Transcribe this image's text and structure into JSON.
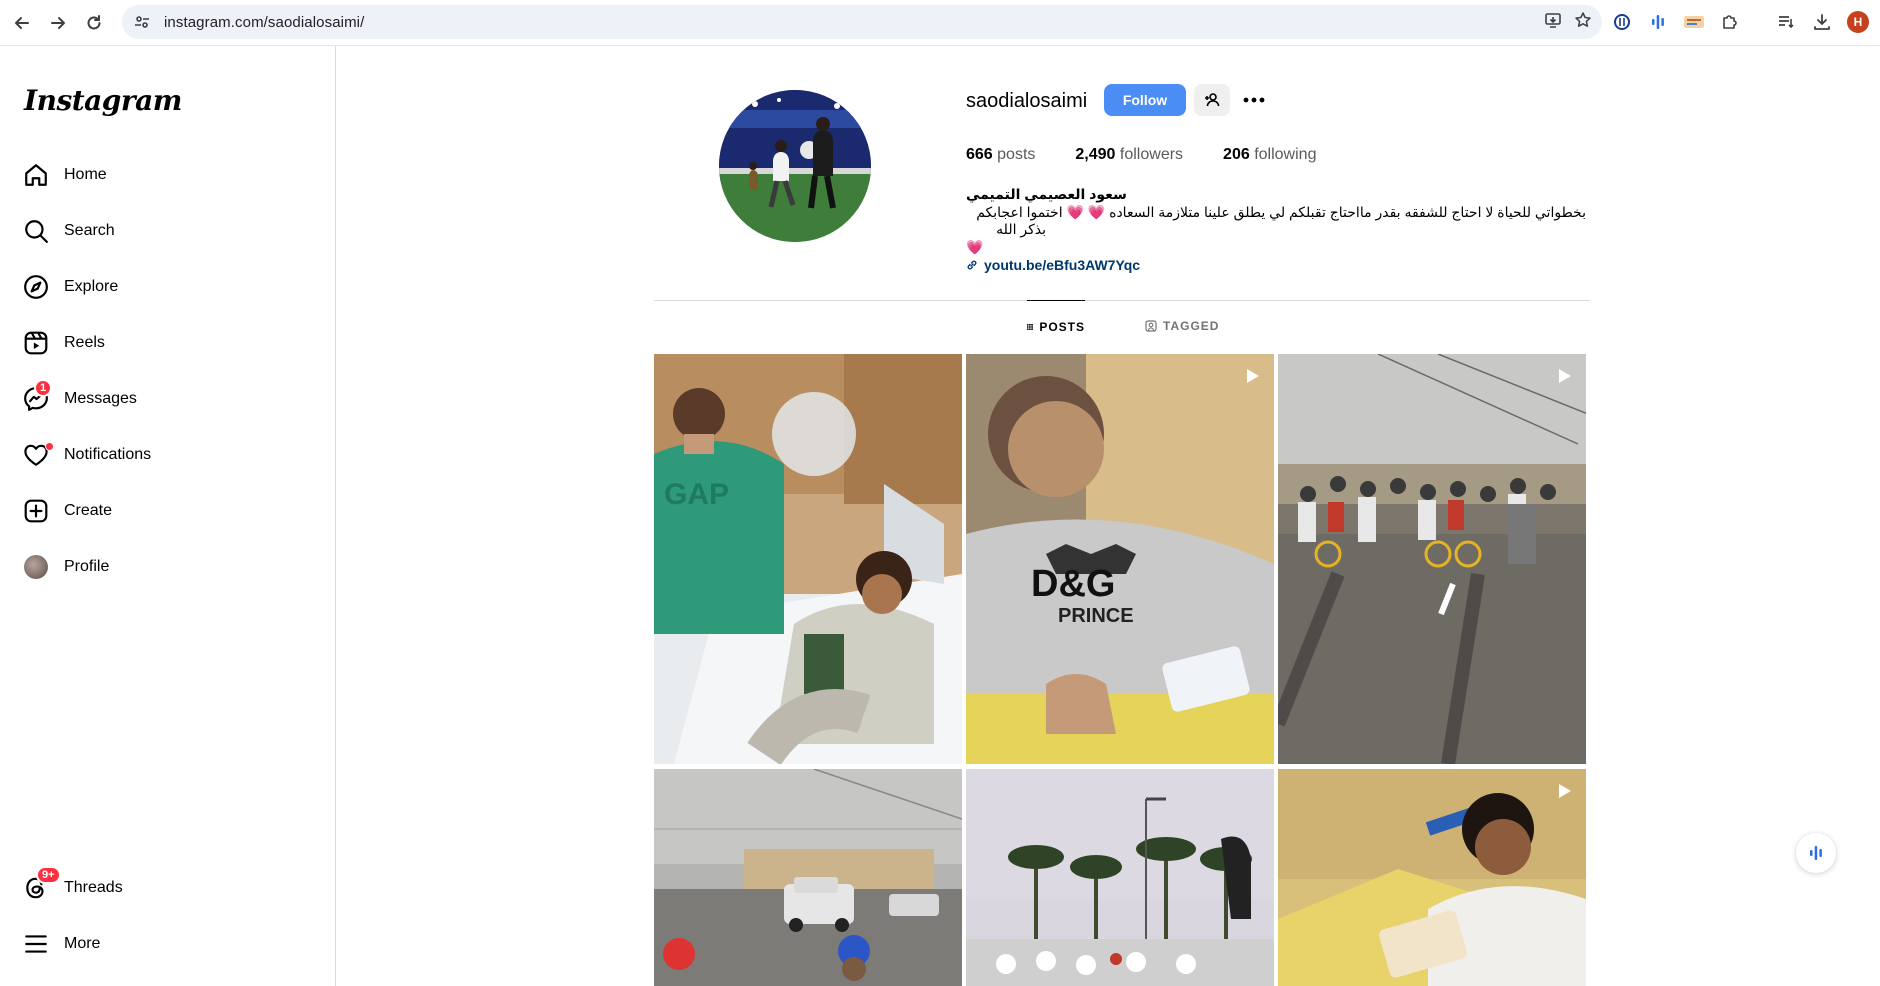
{
  "browser": {
    "url": "instagram.com/saodialosaimi/",
    "profile_initial": "H"
  },
  "sidebar": {
    "logo": "Instagram",
    "items": [
      {
        "label": "Home"
      },
      {
        "label": "Search"
      },
      {
        "label": "Explore"
      },
      {
        "label": "Reels"
      },
      {
        "label": "Messages",
        "badge": "1"
      },
      {
        "label": "Notifications"
      },
      {
        "label": "Create"
      },
      {
        "label": "Profile"
      },
      {
        "label": "Threads",
        "badge": "9+"
      },
      {
        "label": "More"
      }
    ]
  },
  "profile": {
    "username": "saodialosaimi",
    "follow_label": "Follow",
    "stats": {
      "posts_count": "666",
      "posts_label": "posts",
      "followers_count": "2,490",
      "followers_label": "followers",
      "following_count": "206",
      "following_label": "following"
    },
    "full_name": "سعود العصيمي التميمي",
    "bio_line1": "بخطواتي للحياة لا احتاج للشفقه بقدر مااحتاج تقبلكم لي يطلق علينا متلازمة السعاده 💗 💗 اختموا اعجابكم",
    "bio_line2": "بذكر الله",
    "bio_line3": "💗",
    "link": "youtu.be/eBfu3AW7Yqc"
  },
  "tabs": [
    {
      "label": "POSTS",
      "active": true
    },
    {
      "label": "TAGGED",
      "active": false
    }
  ],
  "posts": [
    {
      "kind": "photo",
      "overlay": ""
    },
    {
      "kind": "reel",
      "overlay": "D&G"
    },
    {
      "kind": "reel",
      "overlay": ""
    },
    {
      "kind": "photo",
      "overlay": ""
    },
    {
      "kind": "photo",
      "overlay": ""
    },
    {
      "kind": "reel",
      "overlay": ""
    }
  ],
  "post_overlay_2b": "PRINCE"
}
